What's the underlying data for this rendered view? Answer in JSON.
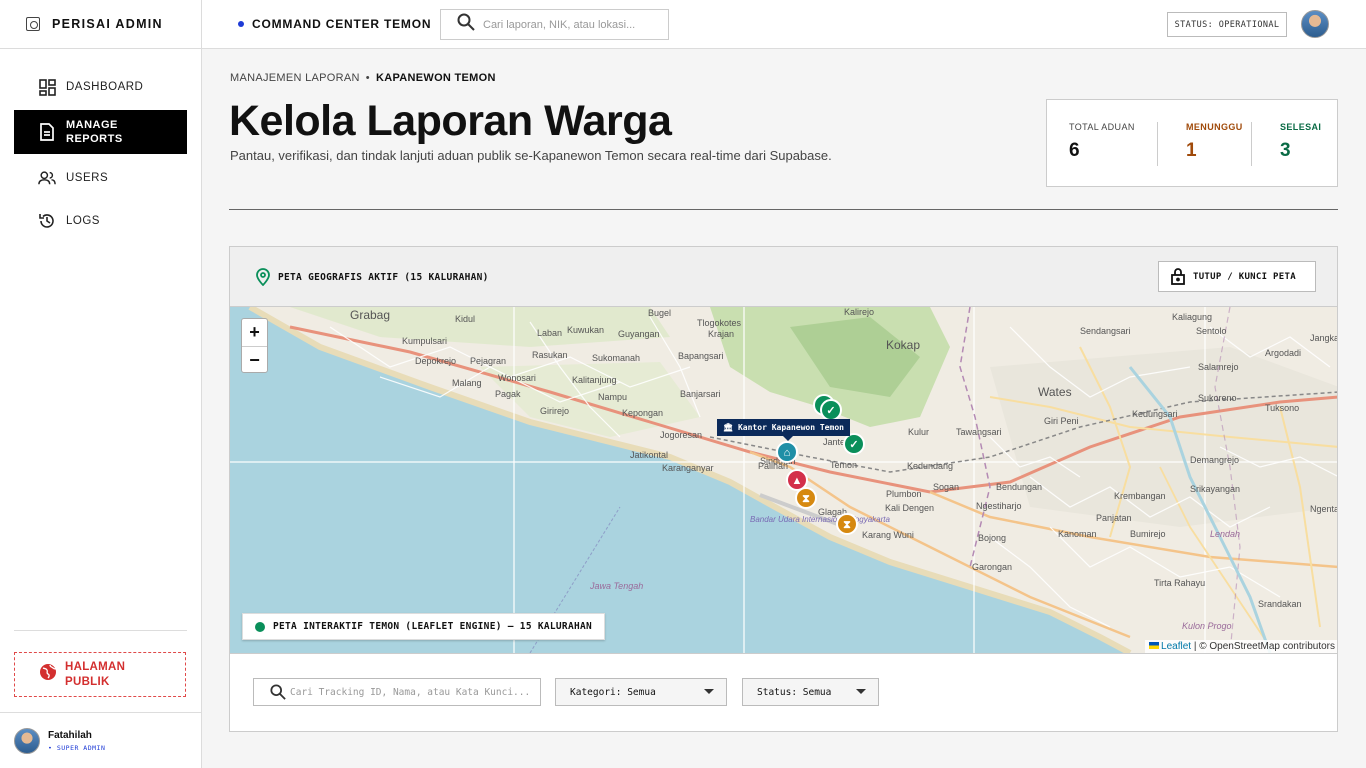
{
  "brand": {
    "name": "PERISAI ADMIN"
  },
  "sidebar": {
    "items": [
      {
        "label": "DASHBOARD",
        "icon": "dashboard-icon"
      },
      {
        "label": "MANAGE REPORTS",
        "icon": "document-icon"
      },
      {
        "label": "USERS",
        "icon": "users-icon"
      },
      {
        "label": "LOGS",
        "icon": "history-icon"
      }
    ],
    "public_button": "HALAMAN PUBLIK",
    "user": {
      "name": "Fatahilah",
      "role": "• SUPER ADMIN"
    }
  },
  "header": {
    "command_center": "COMMAND CENTER TEMON",
    "search_placeholder": "Cari laporan, NIK, atau lokasi...",
    "status": "STATUS: OPERATIONAL"
  },
  "breadcrumb": {
    "parent": "MANAJEMEN LAPORAN",
    "separator": "•",
    "current": "KAPANEWON TEMON"
  },
  "page": {
    "title": "Kelola Laporan Warga",
    "subtitle": "Pantau, verifikasi, dan tindak lanjuti aduan publik se-Kapanewon Temon secara real-time dari Supabase."
  },
  "stats": [
    {
      "label": "TOTAL ADUAN",
      "value": "6",
      "color": "#111111"
    },
    {
      "label": "MENUNGGU",
      "value": "1",
      "color": "#a04a0a"
    },
    {
      "label": "SELESAI",
      "value": "3",
      "color": "#0a6b45"
    }
  ],
  "map_card": {
    "title": "PETA GEOGRAFIS AKTIF (15 KALURAHAN)",
    "lock_button": "TUTUP / KUNCI PETA",
    "zoom_in": "+",
    "zoom_out": "−",
    "badge": "PETA INTERAKTIF TEMON (LEAFLET ENGINE) — 15 KALURAHAN",
    "marker_label": "Kantor Kapanewon Temon",
    "attribution_link": "Leaflet",
    "attribution_text": "| © OpenStreetMap contributors",
    "places": [
      "Grabag",
      "Kidul",
      "Kumpulsari",
      "Depokrejo",
      "Pejagran",
      "Malang",
      "Wonosari",
      "Pagak",
      "Laban",
      "Kuwukan",
      "Rasukan",
      "Sukomanah",
      "Kalitanjung",
      "Nampu",
      "Girirejo",
      "Kepongan",
      "Jogoresan",
      "Jatikontal",
      "Karanganyar",
      "Bugel",
      "Guyangan",
      "Tlogokotes",
      "Krajan",
      "Bapangsari",
      "Banjarsari",
      "Kalirejo",
      "Kokap",
      "Kulur",
      "Tawangsari",
      "Kedundang",
      "Temon",
      "Plumbon",
      "Kali Dengen",
      "Glagah",
      "Karang Wuni",
      "Bandar Udara Internasional Yogyakarta",
      "Sogan",
      "Bendungan",
      "Ngestiharjo",
      "Wates",
      "Giri Peni",
      "Kedungsari",
      "Sendangsari",
      "Kaliagung",
      "Sentolo",
      "Argodadi",
      "Salamrejo",
      "Sukoreno",
      "Tuksono",
      "Demangrejo",
      "Srikayangan",
      "Krembangan",
      "Panjatan",
      "Kanoman",
      "Bumirejo",
      "Bojong",
      "Garongan",
      "Tirta Rahayu",
      "Srandakan",
      "Ngentakrejo",
      "Jawa Tengah",
      "Kulon Progo",
      "Lendah",
      "Palihan",
      "Sindutan",
      "Janten",
      "Jangkaran"
    ]
  },
  "filters": {
    "search_placeholder": "Cari Tracking ID, Nama, atau Kata Kunci...",
    "category": "Kategori: Semua",
    "status": "Status: Semua"
  },
  "markers": [
    {
      "type": "check",
      "color": "#0a8f5a"
    },
    {
      "type": "check",
      "color": "#0a8f5a"
    },
    {
      "type": "check",
      "color": "#0a8f5a"
    },
    {
      "type": "office",
      "color": "#1f8fa6"
    },
    {
      "type": "alert",
      "color": "#d32f4a"
    },
    {
      "type": "pending",
      "color": "#d68910"
    },
    {
      "type": "pending",
      "color": "#d68910"
    }
  ]
}
